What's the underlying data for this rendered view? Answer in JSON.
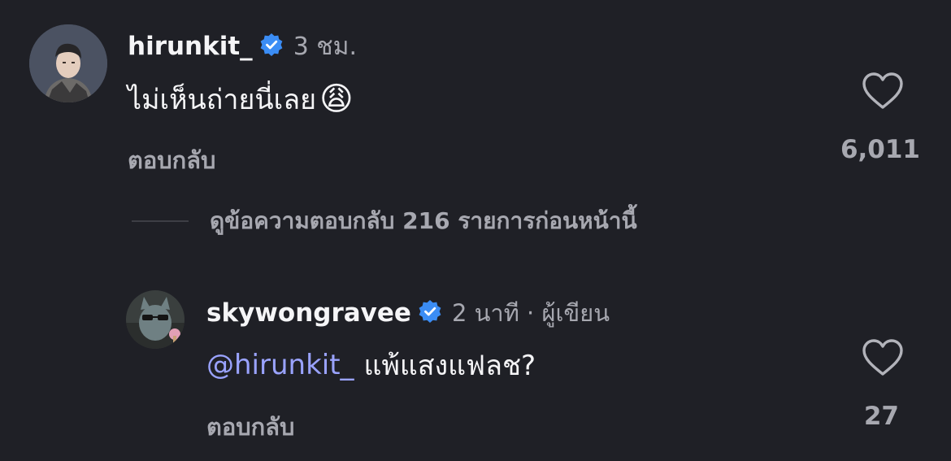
{
  "colors": {
    "background": "#1f2026",
    "text_primary": "#f5f5f7",
    "text_secondary": "#a7a8b0",
    "mention": "#9aa3ff",
    "verified": "#3b8df5"
  },
  "comments": [
    {
      "username": "hirunkit_",
      "verified": true,
      "time": "3 ชม.",
      "text": "ไม่เห็นถ่ายนี่เลย",
      "emoji": "😩",
      "reply_label": "ตอบกลับ",
      "like_count": "6,011",
      "like_icon": "heart-outline-icon"
    }
  ],
  "view_replies": {
    "label": "ดูข้อความตอบกลับ 216 รายการก่อนหน้านี้"
  },
  "replies": [
    {
      "username": "skywongravee",
      "verified": true,
      "meta": "2 นาที · ผู้เขียน",
      "mention": "@hirunkit_",
      "text": "แพ้แสงแฟลช?",
      "reply_label": "ตอบกลับ",
      "like_count": "27",
      "like_icon": "heart-outline-icon"
    }
  ]
}
